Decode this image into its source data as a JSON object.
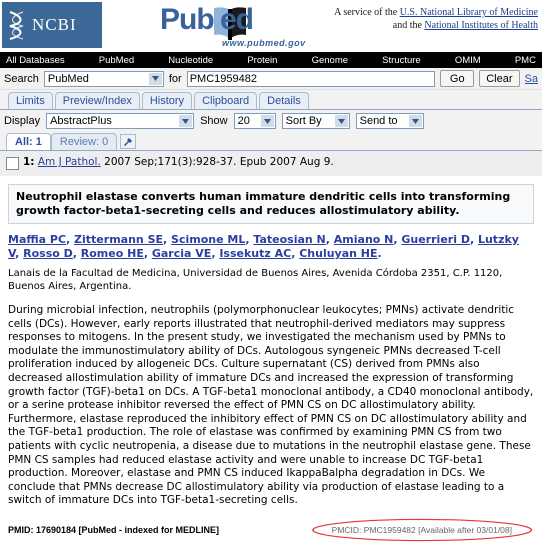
{
  "header": {
    "ncbi_label": "NCBI",
    "ncbi_helix_icon": "dna-helix-icon",
    "ncbi_bg": "#3c6997",
    "pubmed_logo": {
      "part1": "Pub",
      "part2": "ed",
      "book_icon": "open-book-icon",
      "url": "www.pubmed.gov",
      "color": "#37629b"
    },
    "service_prefix": "A service of the",
    "service_link1": "U.S. National Library of Medicine",
    "service_middle": "and the",
    "service_link2": "National Institutes of Health"
  },
  "navbar": {
    "items": [
      {
        "label": "All Databases"
      },
      {
        "label": "PubMed"
      },
      {
        "label": "Nucleotide"
      },
      {
        "label": "Protein"
      },
      {
        "label": "Genome"
      },
      {
        "label": "Structure"
      },
      {
        "label": "OMIM"
      },
      {
        "label": "PMC"
      }
    ]
  },
  "search": {
    "search_label": "Search",
    "database_value": "PubMed",
    "for_label": "for",
    "query_value": "PMC1959482",
    "query_placeholder": "",
    "go_label": "Go",
    "clear_label": "Clear",
    "save_label": "Sa",
    "dropdown_icon": "chevron-down-icon"
  },
  "tabs": [
    {
      "label": "Limits"
    },
    {
      "label": "Preview/Index"
    },
    {
      "label": "History"
    },
    {
      "label": "Clipboard"
    },
    {
      "label": "Details"
    }
  ],
  "display_toolbar": {
    "display_label": "Display",
    "display_value": "AbstractPlus",
    "show_label": "Show",
    "show_value": "20",
    "sort_value": "Sort By",
    "send_value": "Send to"
  },
  "result_tabs": {
    "all_label": "All: 1",
    "review_label": "Review: 0",
    "tools_icon": "tools-icon"
  },
  "citation": {
    "number": "1:",
    "journal": "Am J Pathol.",
    "details": " 2007 Sep;171(3):928-37. Epub 2007 Aug 9.",
    "checkbox_checked": false
  },
  "article": {
    "title": "Neutrophil elastase converts human immature dendritic cells into transforming growth factor-beta1-secreting cells and reduces allostimulatory ability.",
    "authors": [
      "Maffia PC",
      "Zittermann SE",
      "Scimone ML",
      "Tateosian N",
      "Amiano N",
      "Guerrieri D",
      "Lutzky V",
      "Rosso D",
      "Romeo HE",
      "Garcia VE",
      "Issekutz AC",
      "Chuluyan HE"
    ],
    "affiliation": "Lanais de la Facultad de Medicina, Universidad de Buenos Aires, Avenida Córdoba 2351, C.P. 1120, Buenos Aires, Argentina.",
    "abstract": "During microbial infection, neutrophils (polymorphonuclear leukocytes; PMNs) activate dendritic cells (DCs). However, early reports illustrated that neutrophil-derived mediators may suppress responses to mitogens. In the present study, we investigated the mechanism used by PMNs to modulate the immunostimulatory ability of DCs. Autologous syngeneic PMNs decreased T-cell proliferation induced by allogeneic DCs. Culture supernatant (CS) derived from PMNs also decreased allostimulation ability of immature DCs and increased the expression of transforming growth factor (TGF)-beta1 on DCs. A TGF-beta1 monoclonal antibody, a CD40 monoclonal antibody, or a serine protease inhibitor reversed the effect of PMN CS on DC allostimulatory ability. Furthermore, elastase reproduced the inhibitory effect of PMN CS on DC allostimulatory ability and the TGF-beta1 production. The role of elastase was confirmed by examining PMN CS from two patients with cyclic neutropenia, a disease due to mutations in the neutrophil elastase gene. These PMN CS samples had reduced elastase activity and were unable to increase DC TGF-beta1 production. Moreover, elastase and PMN CS induced IkappaBalpha degradation in DCs. We conclude that PMNs decrease DC allostimulatory ability via production of elastase leading to a switch of immature DCs into TGF-beta1-secreting cells.",
    "pmid_text": "PMID: 17690184 [PubMed - indexed for MEDLINE]",
    "pmcid_text": "PMCID: PMC1959482 [Available after 03/01/08]",
    "annotation_color": "#e8343a"
  }
}
